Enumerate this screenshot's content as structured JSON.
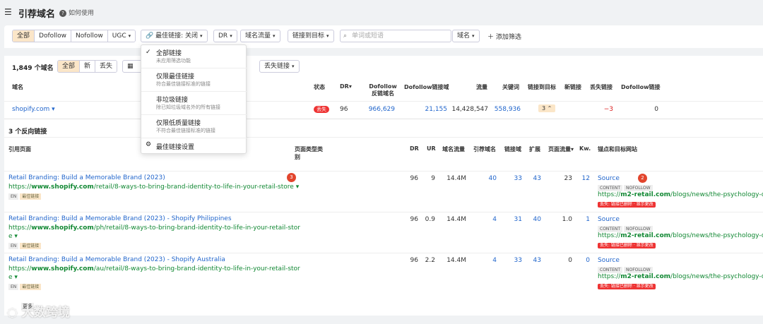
{
  "header": {
    "title": "引荐域名",
    "help": "如何使用"
  },
  "filters": {
    "link_types": [
      "全部",
      "Dofollow",
      "Nofollow",
      "UGC"
    ],
    "best_links": "最佳链接: 关闭",
    "dr": "DR",
    "domain_traffic": "域名流量",
    "link_to_target": "链接到目标",
    "search_placeholder": "单词或短语",
    "search_scope": "域名",
    "add_filter": "添加筛选"
  },
  "dropdown": {
    "items": [
      {
        "title": "全部链接",
        "desc": "未应用筛选功能",
        "checked": true
      },
      {
        "title": "仅限最佳链接",
        "desc": "符合最佳链接标准的链接",
        "checked": false
      },
      {
        "title": "非垃圾链接",
        "desc": "除已知垃圾域名外的所有链接",
        "checked": false
      },
      {
        "title": "仅限低质量链接",
        "desc": "不符合最佳链接标准的链接",
        "checked": false
      }
    ],
    "settings": "最佳链接设置"
  },
  "summary": {
    "count": "1,849 个域名",
    "tabs": [
      "全部",
      "新",
      "丢失"
    ],
    "lost_links": "丢失链接"
  },
  "domain_table": {
    "columns": [
      "域名",
      "状态",
      "DR",
      "Dofollow反链域名",
      "Dofollow链接域",
      "流量",
      "关键词",
      "链接到目标",
      "新链接",
      "丢失链接",
      "Dofollow链接"
    ],
    "row": {
      "domain": "shopify.com",
      "status": "丢失",
      "dr": "96",
      "dofollow_ref": "966,629",
      "dofollow_linked": "21,155",
      "traffic": "14,428,547",
      "keywords": "558,936",
      "links_to_target": "3",
      "lost": "−3",
      "dofollow_links": "0"
    }
  },
  "backlinks": {
    "count": "3 个反向链接",
    "columns": [
      "引用页面",
      "页面类型类别",
      "DR",
      "UR",
      "域名流量",
      "引荐域名",
      "链接域",
      "扩展",
      "页面流量",
      "Kw.",
      "锚点和目标网站"
    ],
    "rows": [
      {
        "title": "Retail Branding: Build a Memorable Brand (2023)",
        "url_pre": "https://",
        "url_bold": "www.shopify.com",
        "url_rest": "/retail/8-ways-to-bring-brand-identity-to-life-in-your-retail-store",
        "url_wrap": "",
        "lang": "EN",
        "best": "最佳链接",
        "dr": "96",
        "ur": "9",
        "dtraffic": "14.4M",
        "refdomains": "40",
        "linked": "33",
        "ext": "43",
        "ptraffic": "23",
        "kw": "12",
        "anchor": "Source",
        "tag1": "CONTENT",
        "tag2": "NOFOLLOW",
        "target_pre": "https://",
        "target_bold": "m2-retail.com",
        "target_rest": "/blogs/news/the-psychology-of-re",
        "lost_note": "丢失: 链接已删除 · 显示更改"
      },
      {
        "title": "Retail Branding: Build a Memorable Brand (2023) - Shopify Philippines",
        "url_pre": "https://",
        "url_bold": "www.shopify.com",
        "url_rest": "/ph/retail/8-ways-to-bring-brand-identity-to-life-in-your-retail-stor",
        "url_wrap": "e",
        "lang": "EN",
        "best": "最佳链接",
        "dr": "96",
        "ur": "0.9",
        "dtraffic": "14.4M",
        "refdomains": "4",
        "linked": "31",
        "ext": "40",
        "ptraffic": "1.0",
        "kw": "1",
        "anchor": "Source",
        "tag1": "CONTENT",
        "tag2": "NOFOLLOW",
        "target_pre": "https://",
        "target_bold": "m2-retail.com",
        "target_rest": "/blogs/news/the-psychology-of-re",
        "lost_note": "丢失: 链接已删除 · 显示更改"
      },
      {
        "title": "Retail Branding: Build a Memorable Brand (2023) - Shopify Australia",
        "url_pre": "https://",
        "url_bold": "www.shopify.com",
        "url_rest": "/au/retail/8-ways-to-bring-brand-identity-to-life-in-your-retail-stor",
        "url_wrap": "e",
        "lang": "EN",
        "best": "最佳链接",
        "dr": "96",
        "ur": "2.2",
        "dtraffic": "14.4M",
        "refdomains": "4",
        "linked": "33",
        "ext": "43",
        "ptraffic": "0",
        "kw": "0",
        "anchor": "Source",
        "tag1": "CONTENT",
        "tag2": "NOFOLLOW",
        "target_pre": "https://",
        "target_bold": "m2-retail.com",
        "target_rest": "/blogs/news/the-psychology-of-re",
        "lost_note": "丢失: 链接已删除 · 显示更改"
      }
    ]
  },
  "markers": [
    "1",
    "2",
    "3"
  ],
  "footer_partial": "更多",
  "watermark": "大数跨境"
}
